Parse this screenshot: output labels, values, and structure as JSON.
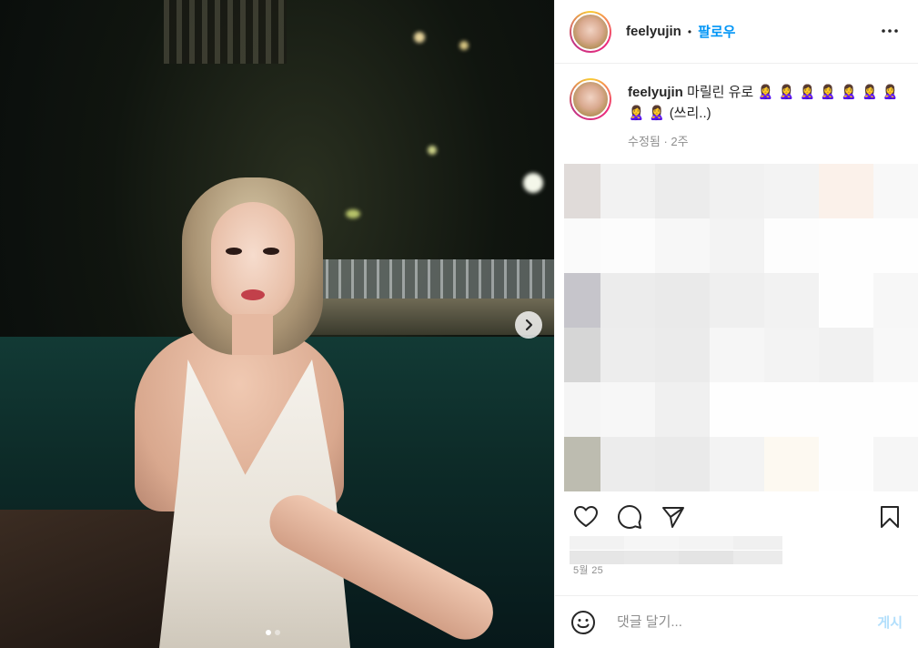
{
  "post": {
    "username": "feelyujin",
    "separator": "•",
    "follow_label": "팔로우",
    "caption_text": "마릴린 유로 🙎‍♀️ 🙎‍♀️ 🙎‍♀️ 🙎‍♀️ 🙎‍♀️ 🙎‍♀️ 🙎‍♀️ 🙎‍♀️ 🙎‍♀️ (쓰리..)",
    "caption_meta": "수정됨 · 2주",
    "date": "5월 25"
  },
  "media": {
    "slide_count": 2,
    "active_slide": 1
  },
  "comment_box": {
    "placeholder": "댓글 달기...",
    "post_label": "게시"
  },
  "icons": {
    "more": "more-horizontal-icon",
    "next": "chevron-right-icon",
    "like": "heart-icon",
    "comment": "comment-bubble-icon",
    "share": "paper-plane-icon",
    "save": "bookmark-icon",
    "emoji": "smiley-icon"
  },
  "colors": {
    "link": "#0095f6",
    "muted": "#8e8e8e",
    "post_disabled": "#b2dffc"
  }
}
